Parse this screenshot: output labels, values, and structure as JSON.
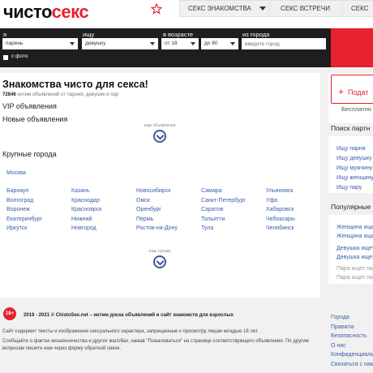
{
  "header": {
    "logo_part1": "чисто",
    "logo_part2": "секс",
    "tabs": [
      "СЕКС ЗНАКОМСТВА",
      "СЕКС ВСТРЕЧИ",
      "СЕКС"
    ]
  },
  "search": {
    "labels": {
      "i": "я",
      "seek": "ищу",
      "age": "в возрасте",
      "city": "из города"
    },
    "values": {
      "i": "парень",
      "seek": "девушку",
      "age_from": "от 18",
      "age_to": "до 80"
    },
    "city_placeholder": "введите город",
    "photo_label": "с фото"
  },
  "main": {
    "title": "Знакомства чисто для секса!",
    "count_number": "72846",
    "count_text": "интим объявлений от парней, девушек и пар",
    "vip": "VIP объявления",
    "new": "Новые объявления",
    "more_ads": "еще объявления",
    "cities_title": "Крупные города",
    "moscow": "Москва",
    "cities": [
      [
        "Барнаул",
        "Волгоград",
        "Воронеж",
        "Екатеринбург",
        "Иркутск"
      ],
      [
        "Казань",
        "Краснодар",
        "Красноярск",
        "Нижний",
        "Новгород"
      ],
      [
        "Новосибирск",
        "Омск",
        "Оренбург",
        "Пермь",
        "Ростов-на-Дону"
      ],
      [
        "Самара",
        "Санкт-Петербург",
        "Саратов",
        "Тольятти",
        "Тула"
      ],
      [
        "Ульяновск",
        "Уфа",
        "Хабаровск",
        "Чебоксары",
        "Челябинск"
      ]
    ],
    "more_cities": "еще города"
  },
  "sidebar": {
    "add_button": "Подат",
    "free_text": "Бесплатно с",
    "search_title": "Поиск партн",
    "search_links": [
      "Ищу парня",
      "Ищу девушку",
      "Ищу мужчину",
      "Ищу женщину",
      "Ищу пару"
    ],
    "popular_title": "Популярные",
    "popular_links": [
      "Женщина ищет",
      "Женщина ищет",
      "Девушка ищет",
      "Девушка ищет",
      "Пара ищет па",
      "Пара ищет па"
    ]
  },
  "footer": {
    "badge": "18+",
    "copyright": "2019 - 2021 © ChistoSex.net – интим доска объявлений и сайт знакомств для взрослых",
    "line1": "Сайт содержит тексты и изображения сексуального характера, запрещенные к просмотру лицам младше 18 лет.",
    "line2": "Сообщайте о фактах мошенничества и других жалобах, нажав \"Пожаловаться\" на странице соответствующего объявления. По другим вопросам пишите нам через форму обратной связи.",
    "links": [
      "Города",
      "Правила",
      "Безопасность",
      "О нас",
      "Конфиденциальн",
      "Связаться с нам"
    ]
  },
  "colors": {
    "accent": "#e8212f",
    "link": "#3a5fa8",
    "dark": "#1e1e1e"
  }
}
